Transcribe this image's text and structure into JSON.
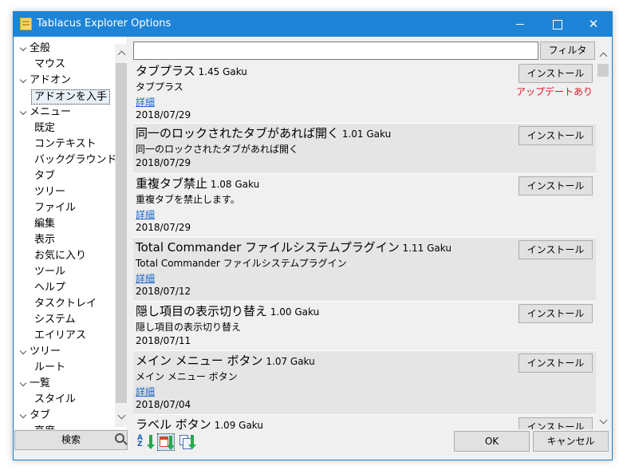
{
  "window": {
    "title": "Tablacus Explorer Options",
    "minimize_glyph": "",
    "maximize_glyph": "",
    "close_glyph": "✕",
    "accent": "#1e84d7"
  },
  "tree": {
    "items": [
      {
        "label": "全般",
        "level": 0,
        "expanded": true
      },
      {
        "label": "マウス",
        "level": 1
      },
      {
        "label": "アドオン",
        "level": 0,
        "expanded": true
      },
      {
        "label": "アドオンを入手",
        "level": 1,
        "selected": true
      },
      {
        "label": "メニュー",
        "level": 0,
        "expanded": true
      },
      {
        "label": "既定",
        "level": 1
      },
      {
        "label": "コンテキスト",
        "level": 1
      },
      {
        "label": "バックグラウンド",
        "level": 1
      },
      {
        "label": "タブ",
        "level": 1
      },
      {
        "label": "ツリー",
        "level": 1
      },
      {
        "label": "ファイル",
        "level": 1
      },
      {
        "label": "編集",
        "level": 1
      },
      {
        "label": "表示",
        "level": 1
      },
      {
        "label": "お気に入り",
        "level": 1
      },
      {
        "label": "ツール",
        "level": 1
      },
      {
        "label": "ヘルプ",
        "level": 1
      },
      {
        "label": "タスクトレイ",
        "level": 1
      },
      {
        "label": "システム",
        "level": 1
      },
      {
        "label": "エイリアス",
        "level": 1
      },
      {
        "label": "ツリー",
        "level": 0,
        "expanded": true
      },
      {
        "label": "ルート",
        "level": 1
      },
      {
        "label": "一覧",
        "level": 0,
        "expanded": true
      },
      {
        "label": "スタイル",
        "level": 1
      },
      {
        "label": "タブ",
        "level": 0,
        "expanded": true
      },
      {
        "label": "高度",
        "level": 1
      }
    ]
  },
  "search_button": "検索",
  "filter": {
    "value": "",
    "placeholder": "",
    "button": "フィルタ"
  },
  "addons": [
    {
      "name": "タブプラス",
      "version": "1.45 Gaku",
      "description": "タブプラス",
      "link": "詳細",
      "date": "2018/07/29",
      "button": "インストール",
      "note": "アップデートあり"
    },
    {
      "name": "同一のロックされたタブがあれば開く",
      "version": "1.01 Gaku",
      "description": "同一のロックされたタブがあれば開く",
      "link": "",
      "date": "2018/07/29",
      "button": "インストール",
      "note": ""
    },
    {
      "name": "重複タブ禁止",
      "version": "1.08 Gaku",
      "description": "重複タブを禁止します。",
      "link": "詳細",
      "date": "2018/07/29",
      "button": "インストール",
      "note": ""
    },
    {
      "name": "Total Commander ファイルシステムプラグイン",
      "version": "1.11 Gaku",
      "description": "Total Commander ファイルシステムプラグイン",
      "link": "詳細",
      "date": "2018/07/12",
      "button": "インストール",
      "note": ""
    },
    {
      "name": "隠し項目の表示切り替え",
      "version": "1.00 Gaku",
      "description": "隠し項目の表示切り替え",
      "link": "",
      "date": "2018/07/11",
      "button": "インストール",
      "note": ""
    },
    {
      "name": "メイン メニュー ボタン",
      "version": "1.07 Gaku",
      "description": "メイン メニュー ボタン",
      "link": "詳細",
      "date": "2018/07/04",
      "button": "インストール",
      "note": ""
    },
    {
      "name": "ラベル ボタン",
      "version": "1.09 Gaku",
      "description": "",
      "link": "",
      "date": "",
      "button": "インストール",
      "note": ""
    }
  ],
  "sort": {
    "name_glyph": "A\nZ",
    "date_glyph": "",
    "other_glyph": "",
    "active": "sort-by-date"
  },
  "buttons": {
    "ok": "OK",
    "cancel": "キャンセル"
  },
  "colors": {
    "update_note": "#e81123",
    "link": "#1a66c8",
    "item_shade": "#e5e5e5"
  }
}
